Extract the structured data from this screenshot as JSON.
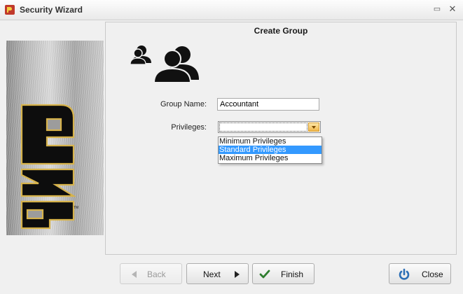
{
  "window": {
    "title": "Security Wizard",
    "minimize_glyph": "▭",
    "close_glyph": "✕"
  },
  "logo": {
    "letters": "PMR",
    "trademark": "TM"
  },
  "panel": {
    "title": "Create Group"
  },
  "form": {
    "group_name_label": "Group Name:",
    "group_name_value": "Accountant",
    "privileges_label": "Privileges:",
    "privileges_value": "",
    "privileges_options": [
      "Minimum Privileges",
      "Standard Privileges",
      "Maximum Privileges"
    ],
    "privileges_highlighted": "Standard Privileges"
  },
  "buttons": {
    "back": "Back",
    "next": "Next",
    "finish": "Finish",
    "close": "Close"
  },
  "icons": {
    "app": "pmr-app-icon",
    "group": "users-group-icon",
    "back": "arrow-left-icon",
    "next": "arrow-right-icon",
    "finish": "checkmark-icon",
    "close": "power-icon"
  },
  "colors": {
    "highlight": "#3399ff",
    "finish_check": "#2e7d2e",
    "close_power": "#2d6fb5",
    "logo_gold": "#d7b34b"
  }
}
